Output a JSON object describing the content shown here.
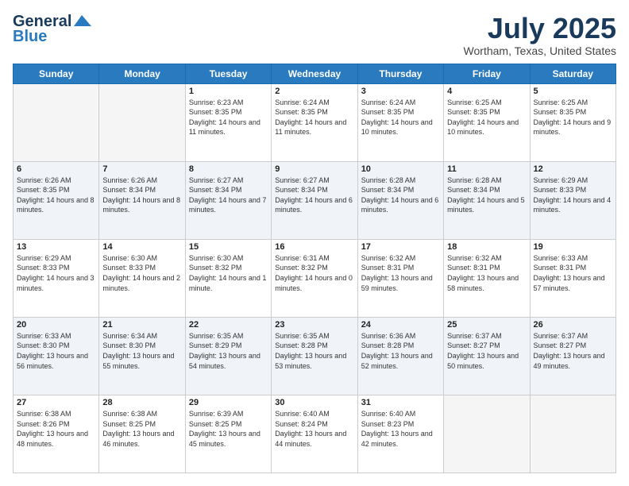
{
  "header": {
    "logo_line1": "General",
    "logo_line2": "Blue",
    "month": "July 2025",
    "location": "Wortham, Texas, United States"
  },
  "days_of_week": [
    "Sunday",
    "Monday",
    "Tuesday",
    "Wednesday",
    "Thursday",
    "Friday",
    "Saturday"
  ],
  "weeks": [
    [
      {
        "day": "",
        "info": ""
      },
      {
        "day": "",
        "info": ""
      },
      {
        "day": "1",
        "info": "Sunrise: 6:23 AM\nSunset: 8:35 PM\nDaylight: 14 hours and 11 minutes."
      },
      {
        "day": "2",
        "info": "Sunrise: 6:24 AM\nSunset: 8:35 PM\nDaylight: 14 hours and 11 minutes."
      },
      {
        "day": "3",
        "info": "Sunrise: 6:24 AM\nSunset: 8:35 PM\nDaylight: 14 hours and 10 minutes."
      },
      {
        "day": "4",
        "info": "Sunrise: 6:25 AM\nSunset: 8:35 PM\nDaylight: 14 hours and 10 minutes."
      },
      {
        "day": "5",
        "info": "Sunrise: 6:25 AM\nSunset: 8:35 PM\nDaylight: 14 hours and 9 minutes."
      }
    ],
    [
      {
        "day": "6",
        "info": "Sunrise: 6:26 AM\nSunset: 8:35 PM\nDaylight: 14 hours and 8 minutes."
      },
      {
        "day": "7",
        "info": "Sunrise: 6:26 AM\nSunset: 8:34 PM\nDaylight: 14 hours and 8 minutes."
      },
      {
        "day": "8",
        "info": "Sunrise: 6:27 AM\nSunset: 8:34 PM\nDaylight: 14 hours and 7 minutes."
      },
      {
        "day": "9",
        "info": "Sunrise: 6:27 AM\nSunset: 8:34 PM\nDaylight: 14 hours and 6 minutes."
      },
      {
        "day": "10",
        "info": "Sunrise: 6:28 AM\nSunset: 8:34 PM\nDaylight: 14 hours and 6 minutes."
      },
      {
        "day": "11",
        "info": "Sunrise: 6:28 AM\nSunset: 8:34 PM\nDaylight: 14 hours and 5 minutes."
      },
      {
        "day": "12",
        "info": "Sunrise: 6:29 AM\nSunset: 8:33 PM\nDaylight: 14 hours and 4 minutes."
      }
    ],
    [
      {
        "day": "13",
        "info": "Sunrise: 6:29 AM\nSunset: 8:33 PM\nDaylight: 14 hours and 3 minutes."
      },
      {
        "day": "14",
        "info": "Sunrise: 6:30 AM\nSunset: 8:33 PM\nDaylight: 14 hours and 2 minutes."
      },
      {
        "day": "15",
        "info": "Sunrise: 6:30 AM\nSunset: 8:32 PM\nDaylight: 14 hours and 1 minute."
      },
      {
        "day": "16",
        "info": "Sunrise: 6:31 AM\nSunset: 8:32 PM\nDaylight: 14 hours and 0 minutes."
      },
      {
        "day": "17",
        "info": "Sunrise: 6:32 AM\nSunset: 8:31 PM\nDaylight: 13 hours and 59 minutes."
      },
      {
        "day": "18",
        "info": "Sunrise: 6:32 AM\nSunset: 8:31 PM\nDaylight: 13 hours and 58 minutes."
      },
      {
        "day": "19",
        "info": "Sunrise: 6:33 AM\nSunset: 8:31 PM\nDaylight: 13 hours and 57 minutes."
      }
    ],
    [
      {
        "day": "20",
        "info": "Sunrise: 6:33 AM\nSunset: 8:30 PM\nDaylight: 13 hours and 56 minutes."
      },
      {
        "day": "21",
        "info": "Sunrise: 6:34 AM\nSunset: 8:30 PM\nDaylight: 13 hours and 55 minutes."
      },
      {
        "day": "22",
        "info": "Sunrise: 6:35 AM\nSunset: 8:29 PM\nDaylight: 13 hours and 54 minutes."
      },
      {
        "day": "23",
        "info": "Sunrise: 6:35 AM\nSunset: 8:28 PM\nDaylight: 13 hours and 53 minutes."
      },
      {
        "day": "24",
        "info": "Sunrise: 6:36 AM\nSunset: 8:28 PM\nDaylight: 13 hours and 52 minutes."
      },
      {
        "day": "25",
        "info": "Sunrise: 6:37 AM\nSunset: 8:27 PM\nDaylight: 13 hours and 50 minutes."
      },
      {
        "day": "26",
        "info": "Sunrise: 6:37 AM\nSunset: 8:27 PM\nDaylight: 13 hours and 49 minutes."
      }
    ],
    [
      {
        "day": "27",
        "info": "Sunrise: 6:38 AM\nSunset: 8:26 PM\nDaylight: 13 hours and 48 minutes."
      },
      {
        "day": "28",
        "info": "Sunrise: 6:38 AM\nSunset: 8:25 PM\nDaylight: 13 hours and 46 minutes."
      },
      {
        "day": "29",
        "info": "Sunrise: 6:39 AM\nSunset: 8:25 PM\nDaylight: 13 hours and 45 minutes."
      },
      {
        "day": "30",
        "info": "Sunrise: 6:40 AM\nSunset: 8:24 PM\nDaylight: 13 hours and 44 minutes."
      },
      {
        "day": "31",
        "info": "Sunrise: 6:40 AM\nSunset: 8:23 PM\nDaylight: 13 hours and 42 minutes."
      },
      {
        "day": "",
        "info": ""
      },
      {
        "day": "",
        "info": ""
      }
    ]
  ]
}
